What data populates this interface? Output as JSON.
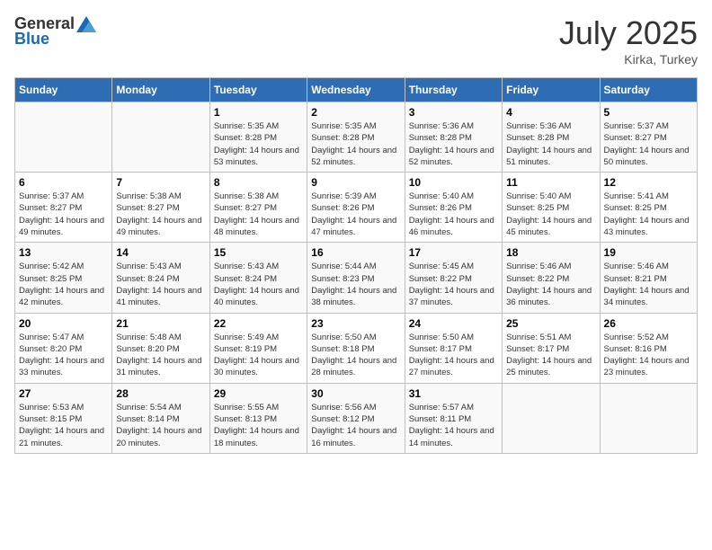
{
  "header": {
    "logo_general": "General",
    "logo_blue": "Blue",
    "title": "July 2025",
    "location": "Kirka, Turkey"
  },
  "days_of_week": [
    "Sunday",
    "Monday",
    "Tuesday",
    "Wednesday",
    "Thursday",
    "Friday",
    "Saturday"
  ],
  "weeks": [
    [
      {
        "num": "",
        "detail": ""
      },
      {
        "num": "",
        "detail": ""
      },
      {
        "num": "1",
        "detail": "Sunrise: 5:35 AM\nSunset: 8:28 PM\nDaylight: 14 hours and 53 minutes."
      },
      {
        "num": "2",
        "detail": "Sunrise: 5:35 AM\nSunset: 8:28 PM\nDaylight: 14 hours and 52 minutes."
      },
      {
        "num": "3",
        "detail": "Sunrise: 5:36 AM\nSunset: 8:28 PM\nDaylight: 14 hours and 52 minutes."
      },
      {
        "num": "4",
        "detail": "Sunrise: 5:36 AM\nSunset: 8:28 PM\nDaylight: 14 hours and 51 minutes."
      },
      {
        "num": "5",
        "detail": "Sunrise: 5:37 AM\nSunset: 8:27 PM\nDaylight: 14 hours and 50 minutes."
      }
    ],
    [
      {
        "num": "6",
        "detail": "Sunrise: 5:37 AM\nSunset: 8:27 PM\nDaylight: 14 hours and 49 minutes."
      },
      {
        "num": "7",
        "detail": "Sunrise: 5:38 AM\nSunset: 8:27 PM\nDaylight: 14 hours and 49 minutes."
      },
      {
        "num": "8",
        "detail": "Sunrise: 5:38 AM\nSunset: 8:27 PM\nDaylight: 14 hours and 48 minutes."
      },
      {
        "num": "9",
        "detail": "Sunrise: 5:39 AM\nSunset: 8:26 PM\nDaylight: 14 hours and 47 minutes."
      },
      {
        "num": "10",
        "detail": "Sunrise: 5:40 AM\nSunset: 8:26 PM\nDaylight: 14 hours and 46 minutes."
      },
      {
        "num": "11",
        "detail": "Sunrise: 5:40 AM\nSunset: 8:25 PM\nDaylight: 14 hours and 45 minutes."
      },
      {
        "num": "12",
        "detail": "Sunrise: 5:41 AM\nSunset: 8:25 PM\nDaylight: 14 hours and 43 minutes."
      }
    ],
    [
      {
        "num": "13",
        "detail": "Sunrise: 5:42 AM\nSunset: 8:25 PM\nDaylight: 14 hours and 42 minutes."
      },
      {
        "num": "14",
        "detail": "Sunrise: 5:43 AM\nSunset: 8:24 PM\nDaylight: 14 hours and 41 minutes."
      },
      {
        "num": "15",
        "detail": "Sunrise: 5:43 AM\nSunset: 8:24 PM\nDaylight: 14 hours and 40 minutes."
      },
      {
        "num": "16",
        "detail": "Sunrise: 5:44 AM\nSunset: 8:23 PM\nDaylight: 14 hours and 38 minutes."
      },
      {
        "num": "17",
        "detail": "Sunrise: 5:45 AM\nSunset: 8:22 PM\nDaylight: 14 hours and 37 minutes."
      },
      {
        "num": "18",
        "detail": "Sunrise: 5:46 AM\nSunset: 8:22 PM\nDaylight: 14 hours and 36 minutes."
      },
      {
        "num": "19",
        "detail": "Sunrise: 5:46 AM\nSunset: 8:21 PM\nDaylight: 14 hours and 34 minutes."
      }
    ],
    [
      {
        "num": "20",
        "detail": "Sunrise: 5:47 AM\nSunset: 8:20 PM\nDaylight: 14 hours and 33 minutes."
      },
      {
        "num": "21",
        "detail": "Sunrise: 5:48 AM\nSunset: 8:20 PM\nDaylight: 14 hours and 31 minutes."
      },
      {
        "num": "22",
        "detail": "Sunrise: 5:49 AM\nSunset: 8:19 PM\nDaylight: 14 hours and 30 minutes."
      },
      {
        "num": "23",
        "detail": "Sunrise: 5:50 AM\nSunset: 8:18 PM\nDaylight: 14 hours and 28 minutes."
      },
      {
        "num": "24",
        "detail": "Sunrise: 5:50 AM\nSunset: 8:17 PM\nDaylight: 14 hours and 27 minutes."
      },
      {
        "num": "25",
        "detail": "Sunrise: 5:51 AM\nSunset: 8:17 PM\nDaylight: 14 hours and 25 minutes."
      },
      {
        "num": "26",
        "detail": "Sunrise: 5:52 AM\nSunset: 8:16 PM\nDaylight: 14 hours and 23 minutes."
      }
    ],
    [
      {
        "num": "27",
        "detail": "Sunrise: 5:53 AM\nSunset: 8:15 PM\nDaylight: 14 hours and 21 minutes."
      },
      {
        "num": "28",
        "detail": "Sunrise: 5:54 AM\nSunset: 8:14 PM\nDaylight: 14 hours and 20 minutes."
      },
      {
        "num": "29",
        "detail": "Sunrise: 5:55 AM\nSunset: 8:13 PM\nDaylight: 14 hours and 18 minutes."
      },
      {
        "num": "30",
        "detail": "Sunrise: 5:56 AM\nSunset: 8:12 PM\nDaylight: 14 hours and 16 minutes."
      },
      {
        "num": "31",
        "detail": "Sunrise: 5:57 AM\nSunset: 8:11 PM\nDaylight: 14 hours and 14 minutes."
      },
      {
        "num": "",
        "detail": ""
      },
      {
        "num": "",
        "detail": ""
      }
    ]
  ]
}
